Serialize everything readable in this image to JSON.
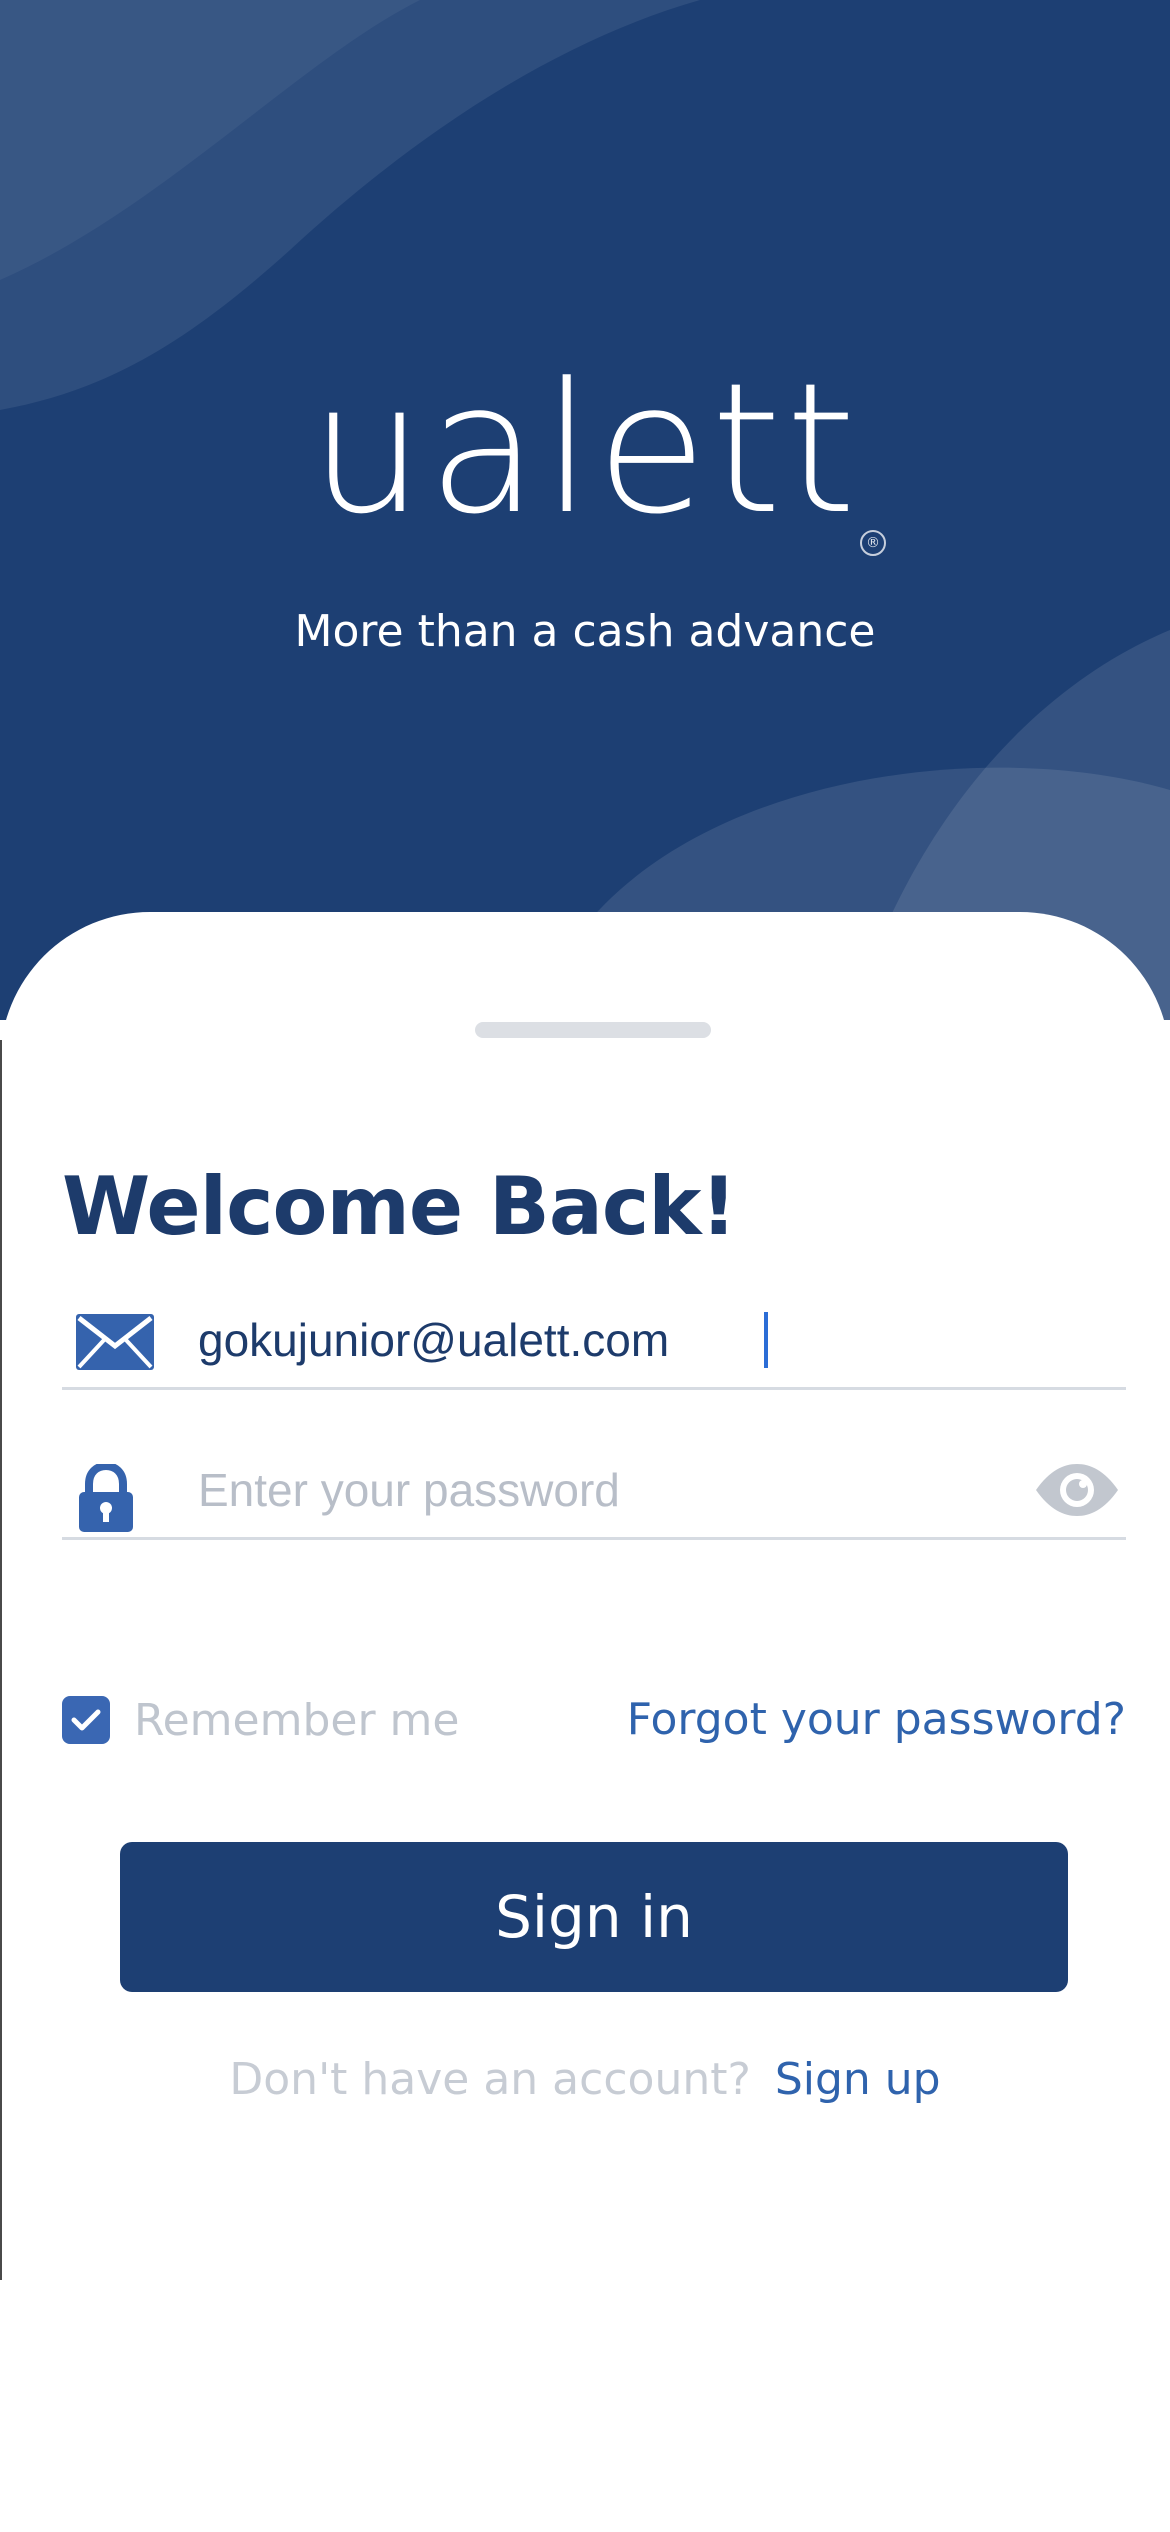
{
  "brand": {
    "logo_text": "ualett",
    "registered_mark": "®",
    "tagline": "More than a cash advance"
  },
  "login": {
    "title": "Welcome Back!",
    "email": {
      "value": "gokujunior@ualett.com",
      "icon": "envelope-icon"
    },
    "password": {
      "value": "",
      "placeholder": "Enter your password",
      "icon": "lock-icon",
      "toggle_icon": "eye-icon"
    },
    "remember_me": {
      "label": "Remember me",
      "checked": true
    },
    "forgot_password_label": "Forgot your password?",
    "sign_in_label": "Sign in",
    "signup_prompt": "Don't have an account?",
    "signup_link": "Sign up"
  },
  "colors": {
    "primary": "#1d3f73",
    "link": "#2f63ad",
    "checkbox": "#3a67b3",
    "placeholder": "#b8bec8"
  }
}
